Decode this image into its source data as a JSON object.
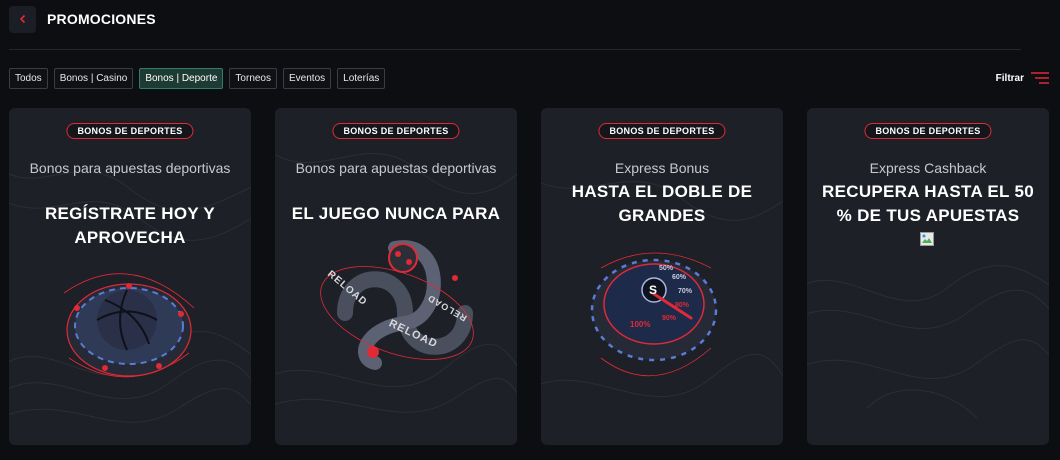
{
  "header": {
    "title": "PROMOCIONES"
  },
  "filters": [
    {
      "label": "Todos",
      "active": false
    },
    {
      "label": "Bonos | Casino",
      "active": false
    },
    {
      "label": "Bonos | Deporte",
      "active": true
    },
    {
      "label": "Torneos",
      "active": false
    },
    {
      "label": "Eventos",
      "active": false
    },
    {
      "label": "Loterías",
      "active": false
    }
  ],
  "filter_button": {
    "label": "Filtrar"
  },
  "colors": {
    "accent_red": "#e02a36",
    "active_chip": "#1d3b33",
    "card_bg": "#1d2027"
  },
  "cards": [
    {
      "badge": "BONOS DE DEPORTES",
      "subtitle": "Bonos para apuestas deportivas",
      "headline": "REGÍSTRATE HOY Y APROVECHA",
      "art": "basketball-chip"
    },
    {
      "badge": "BONOS DE DEPORTES",
      "subtitle": "Bonos para apuestas deportivas",
      "headline": "EL JUEGO NUNCA PARA",
      "art": "reload-infinity",
      "art_text": "RELOAD"
    },
    {
      "badge": "BONOS DE DEPORTES",
      "subtitle": "Express Bonus",
      "headline": "HASTA EL DOBLE DE GRANDES",
      "art": "speedometer-chip",
      "art_text": [
        "100%",
        "90%",
        "80%",
        "70%",
        "60%",
        "50%"
      ]
    },
    {
      "badge": "BONOS DE DEPORTES",
      "subtitle": "Express Cashback",
      "headline": "RECUPERA HASTA EL 50 % DE TUS APUESTAS",
      "art": "broken-image"
    }
  ]
}
